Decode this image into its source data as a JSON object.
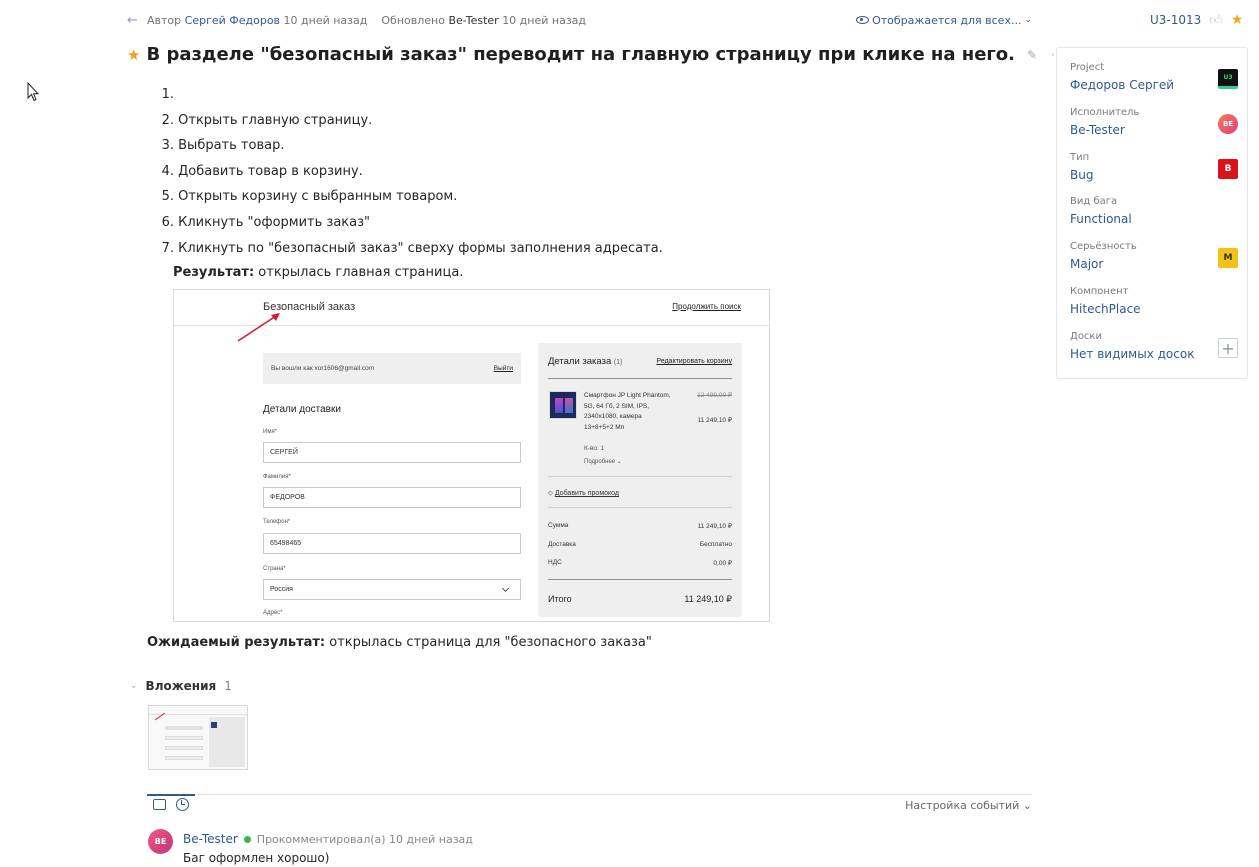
{
  "meta": {
    "author_prefix": "Автор",
    "author": "Сергей Федоров",
    "created": "10 дней назад",
    "updated_prefix": "Обновлено",
    "updater": "Be-Tester",
    "updated": "10 дней назад",
    "visibility": "Отображается для всех...",
    "issue_key": "U3-1013"
  },
  "title": "В разделе \"безопасный заказ\" переводит на главную страницу при клике на него.",
  "steps": [
    {
      "num": "1.",
      "text": ""
    },
    {
      "num": "2.",
      "text": "Открыть главную страницу."
    },
    {
      "num": "3.",
      "text": "Выбрать товар."
    },
    {
      "num": "4.",
      "text": "Добавить товар в корзину."
    },
    {
      "num": "5.",
      "text": "Открыть корзину с выбранным товаром."
    },
    {
      "num": "6.",
      "text": "Кликнуть \"оформить заказ\""
    },
    {
      "num": "7.",
      "text": "Кликнуть по \"безопасный заказ\" сверху формы заполнения адресата."
    }
  ],
  "result": {
    "label": "Результат:",
    "text": " открылась главная страница."
  },
  "screenshot": {
    "header_title": "Безопасный заказ",
    "header_link": "Продолжить поиск",
    "login_text": "Вы вошли как xor1606@gmail.com",
    "logout": "Выйти",
    "delivery_title": "Детали доставки",
    "fields": [
      {
        "label": "Имя*",
        "value": "СЕРГЕЙ"
      },
      {
        "label": "Фамилия*",
        "value": "ФЕДОРОВ"
      },
      {
        "label": "Телефон*",
        "value": "65498465"
      },
      {
        "label": "Страна*",
        "value": "Россия"
      },
      {
        "label": "Адрес*",
        "value": ""
      }
    ],
    "order_title": "Детали заказа",
    "order_count": "(1)",
    "order_edit": "Редактировать корзину",
    "product_name": "Смартфон JP Light Phantom, 5G, 64 Гб, 2 SIM, IPS, 2340x1080, камера 13+8+5+2 Мп",
    "price_old": "12 499,00 ₽",
    "price_new": "11 249,10 ₽",
    "qty": "К-во: 1",
    "more": "Подробнее",
    "promo": "Добавить промокод",
    "rows": [
      {
        "label": "Сумма",
        "value": "11 249,10 ₽"
      },
      {
        "label": "Доставка",
        "value": "Бесплатно"
      },
      {
        "label": "НДС",
        "value": "0,00 ₽"
      }
    ],
    "total_label": "Итого",
    "total_value": "11 249,10 ₽"
  },
  "expected": {
    "label": "Ожидаемый результат:",
    "text": " открылась страница для \"безопасного заказа\""
  },
  "attachments": {
    "label": "Вложения",
    "count": "1"
  },
  "activity": {
    "settings": "Настройка событий"
  },
  "comment": {
    "avatar": "BE",
    "author": "Be-Tester",
    "action": "Прокомментировал(а) 10 дней назад",
    "text": "Баг оформлен хорошо)"
  },
  "panel": {
    "fields": [
      {
        "label": "Project",
        "value": "Федоров Сергей",
        "icon": "project-logo",
        "icon_text": "U3"
      },
      {
        "label": "Исполнитель",
        "value": "Be-Tester",
        "icon": "avatar",
        "icon_text": "BE"
      },
      {
        "label": "Тип",
        "value": "Bug",
        "icon": "type-badge",
        "icon_text": "B"
      },
      {
        "label": "Вид бага",
        "value": "Functional",
        "icon": "",
        "icon_text": ""
      },
      {
        "label": "Серьёзность",
        "value": "Major",
        "icon": "severity-badge",
        "icon_text": "M"
      },
      {
        "label": "Компонент",
        "value": "HitechPlace",
        "icon": "",
        "icon_text": ""
      },
      {
        "label": "Доски",
        "value": "Нет видимых досок",
        "icon": "add-icon",
        "icon_text": "+"
      }
    ]
  },
  "colors": {
    "link": "#2f5a8e",
    "star": "#f0a91e",
    "bug": "#d9131a",
    "major": "#f2c21b",
    "online": "#3ab54a"
  }
}
